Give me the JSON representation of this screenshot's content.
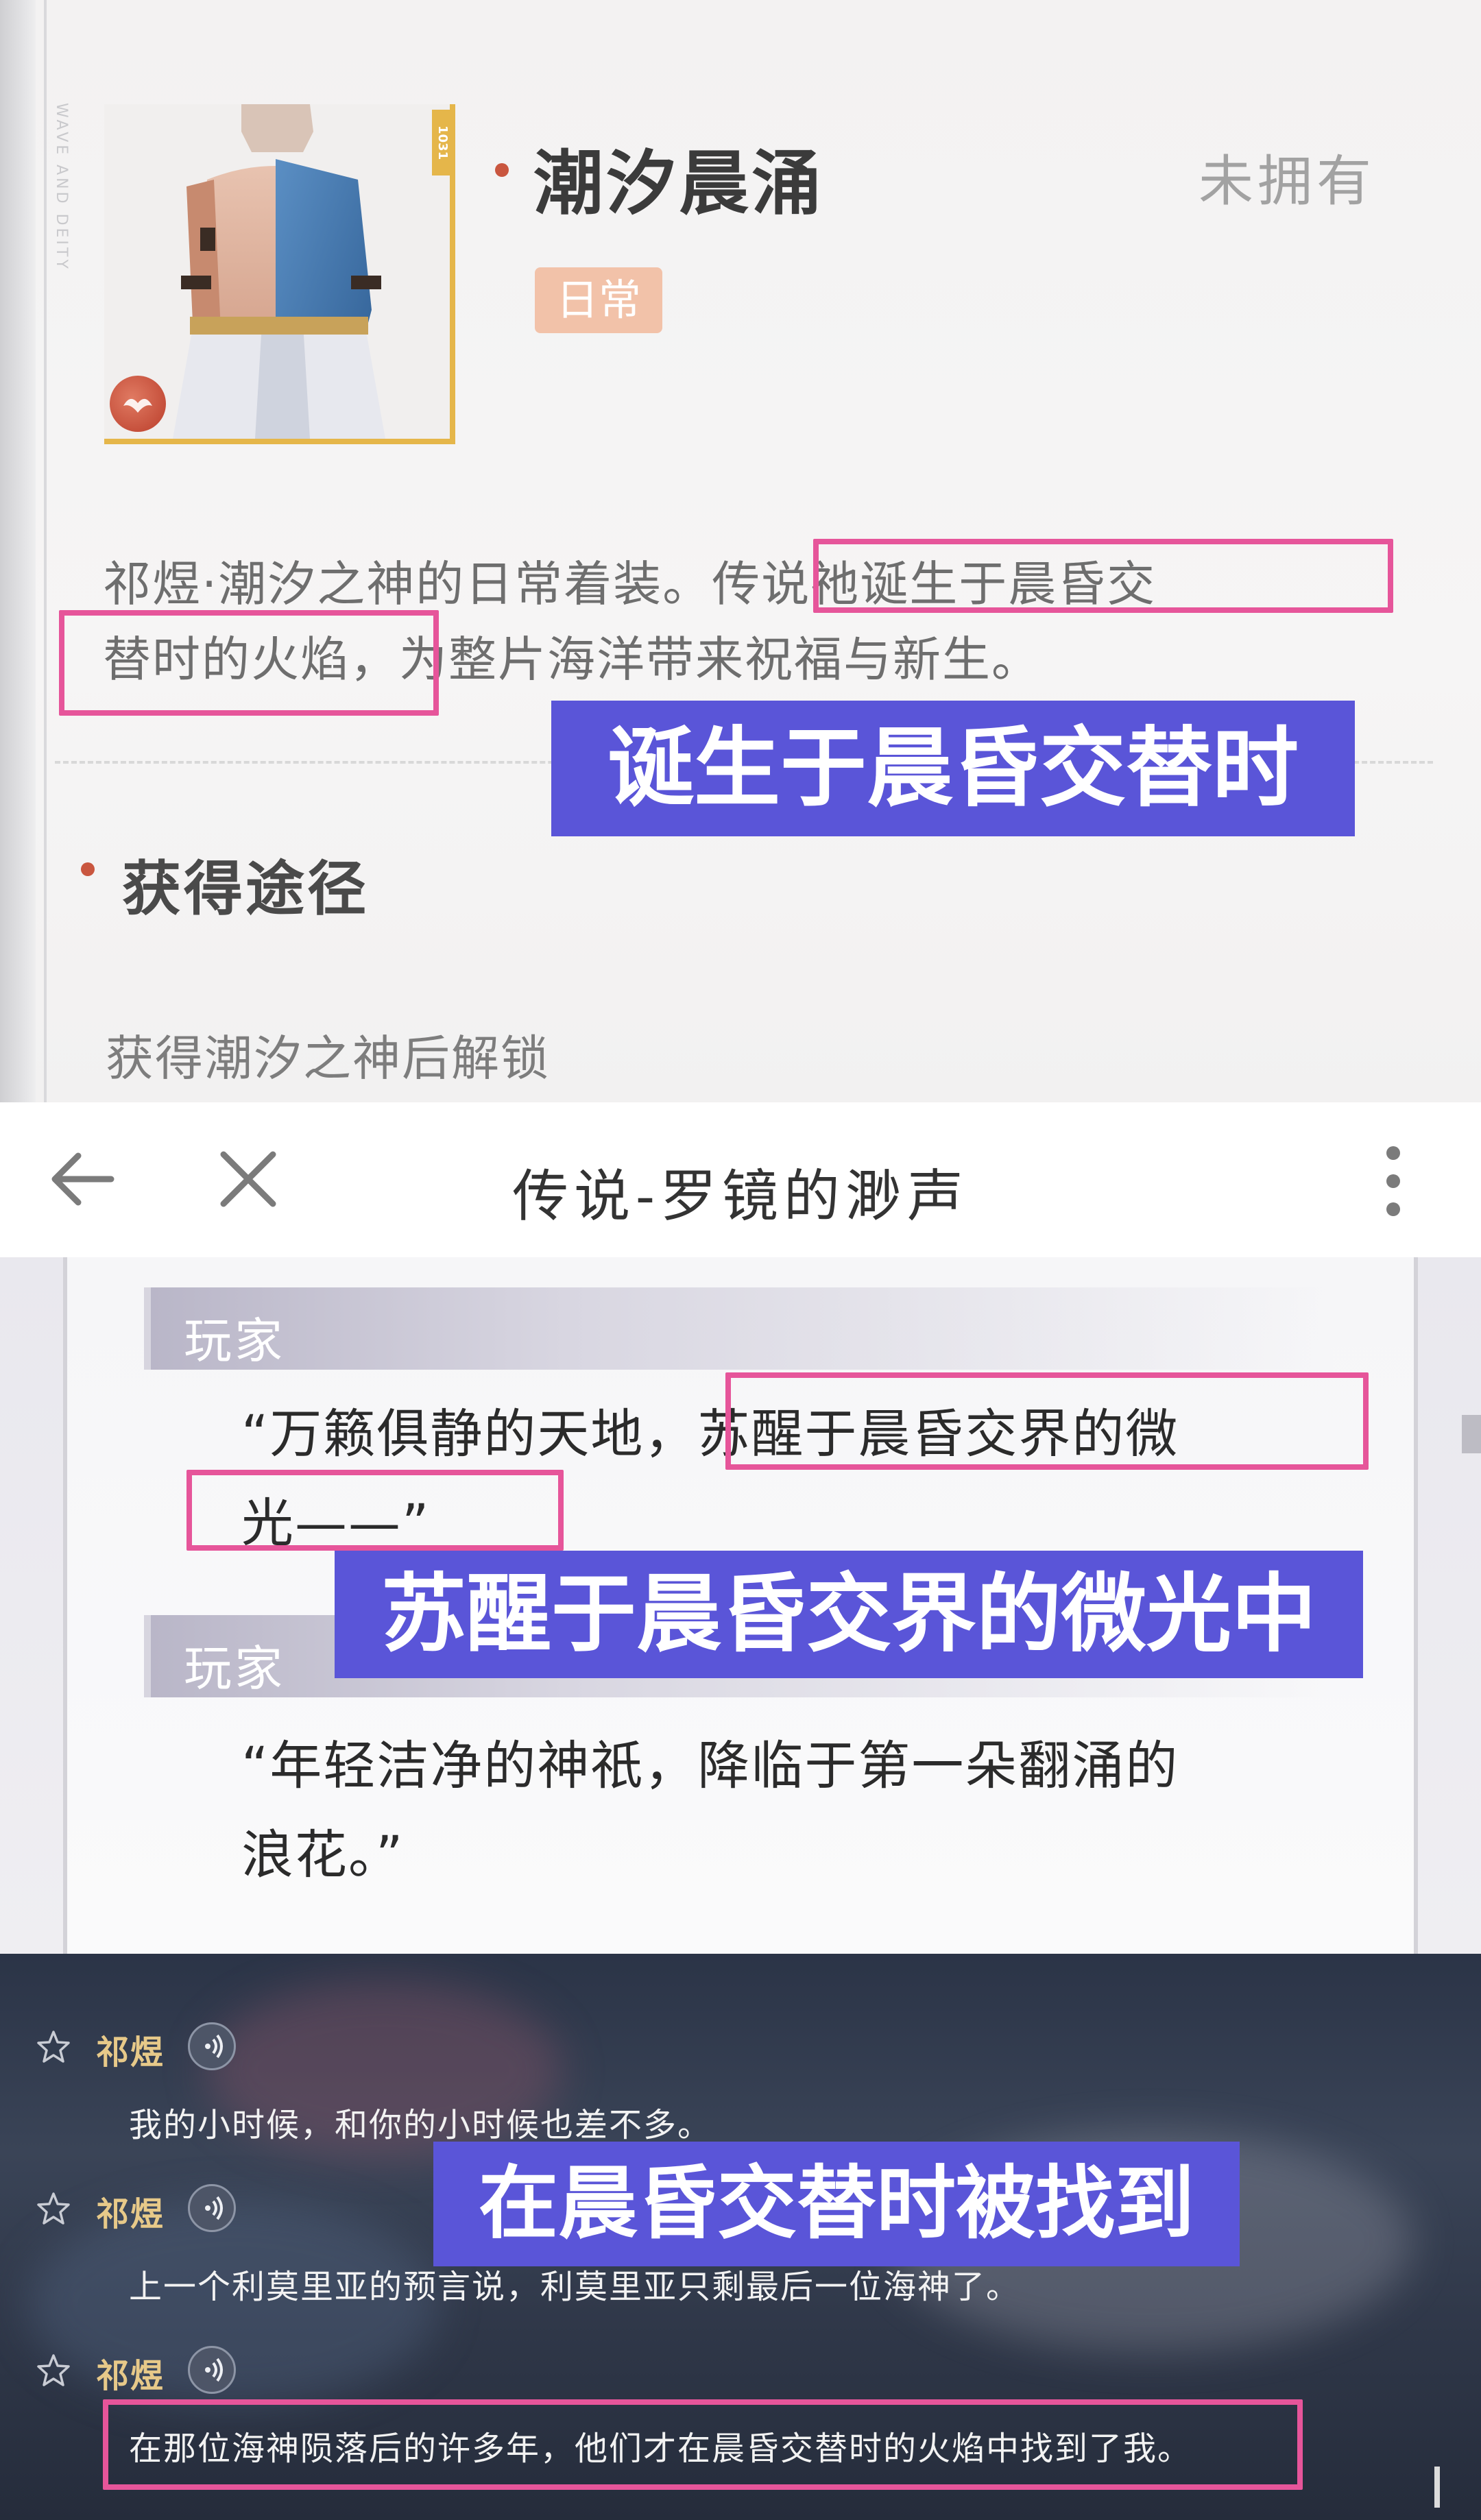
{
  "outfit_card": {
    "portrait_rank": "1031",
    "title": "潮汐晨涌",
    "status": "未拥有",
    "type_badge": "日常",
    "description_line1": "祁煜·潮汐之神的日常着装。传说祂诞生于晨昏交",
    "description_line2": "替时的火焰，为整片海洋带来祝福与新生。",
    "caption": "诞生于晨昏交替时",
    "section_title": "获得途径",
    "unlock_text": "获得潮汐之神后解锁",
    "side_text": "WAVE AND DEITY"
  },
  "header": {
    "title": "传说-罗镜的渺声"
  },
  "dialogue": {
    "entries": [
      {
        "speaker": "玩家",
        "line1": "“万籁俱静的天地，苏醒于晨昏交界的微",
        "line2": "光——”"
      },
      {
        "speaker": "玩家",
        "line1": "“年轻洁净的神祇，降临于第一朵翻涌的",
        "line2": "浪花。”"
      }
    ],
    "caption": "苏醒于晨昏交界的微光中"
  },
  "voice_log": {
    "entries": [
      {
        "speaker": "祁煜",
        "line": "我的小时候，和你的小时候也差不多。"
      },
      {
        "speaker": "祁煜",
        "line": "上一个利莫里亚的预言说，利莫里亚只剩最后一位海神了。"
      },
      {
        "speaker": "祁煜",
        "line": "在那位海神陨落后的许多年，他们才在晨昏交替时的火焰中找到了我。"
      }
    ],
    "caption": "在晨昏交替时被找到"
  },
  "colors": {
    "highlight_border": "#e6559a",
    "caption_bg": "#5a55d8",
    "accent_dot": "#c9563f",
    "badge_bg": "#f2c2a9",
    "frame_gold": "#e5b64a",
    "speaker_gold": "#e7c989"
  },
  "icons": {
    "header_back": "arrow-left-icon",
    "header_close": "close-icon",
    "header_more": "more-vertical-icon",
    "voice_favorite": "star-outline-icon",
    "voice_play": "voice-wave-icon"
  }
}
